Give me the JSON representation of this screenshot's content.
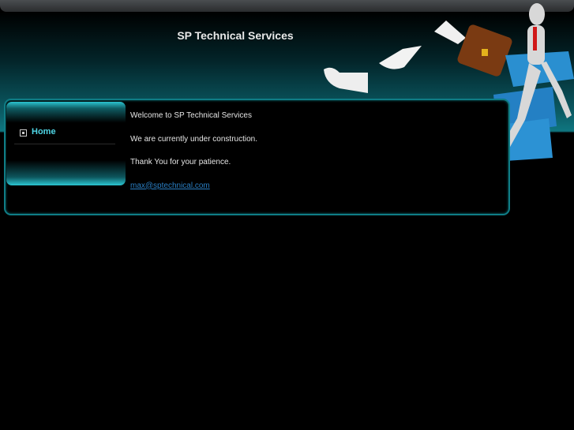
{
  "header": {
    "title": "SP Technical Services"
  },
  "menu": {
    "items": [
      {
        "label": "Home",
        "icon": "bullet-square-icon"
      }
    ]
  },
  "content": {
    "welcome": "Welcome to SP Technical Services",
    "status": "We are currently under construction.",
    "thanks": "Thank You for your patience.",
    "email": "max@sptechnical.com"
  },
  "colors": {
    "accent": "#0f7d86",
    "menu_text": "#4fd6e6",
    "link": "#2a7fc4"
  }
}
